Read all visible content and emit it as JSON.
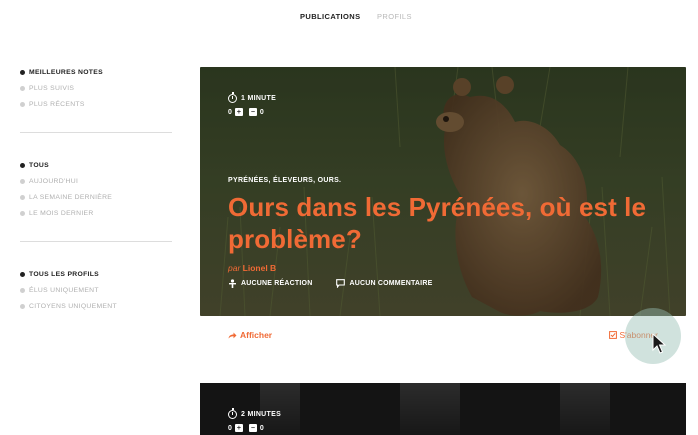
{
  "tabs": {
    "active": "PUBLICATIONS",
    "inactive": "PROFILS"
  },
  "sidebar": {
    "sort": [
      {
        "label": "MEILLEURES NOTES",
        "active": true
      },
      {
        "label": "PLUS SUIVIS",
        "active": false
      },
      {
        "label": "PLUS RÉCENTS",
        "active": false
      }
    ],
    "period": [
      {
        "label": "TOUS",
        "active": true
      },
      {
        "label": "AUJOURD'HUI",
        "active": false
      },
      {
        "label": "LA SEMAINE DERNIÈRE",
        "active": false
      },
      {
        "label": "LE MOIS DERNIER",
        "active": false
      }
    ],
    "profiles": [
      {
        "label": "TOUS LES PROFILS",
        "active": true
      },
      {
        "label": "ÉLUS UNIQUEMENT",
        "active": false
      },
      {
        "label": "CITOYENS UNIQUEMENT",
        "active": false
      }
    ]
  },
  "card1": {
    "readtime": "1 MINUTE",
    "votes_up": "0",
    "votes_down": "0",
    "tags": "PYRÉNÉES, ÉLEVEURS, OURS.",
    "title": "Ours dans les Pyrénées, où est le problème?",
    "by_prefix": "par",
    "author": "Lionel B",
    "reactions": "AUCUNE RÉACTION",
    "comments": "AUCUN COMMENTAIRE",
    "show_label": "Afficher",
    "subscribe_label": "S'abonner"
  },
  "card2": {
    "readtime": "2 MINUTES",
    "votes_up": "0",
    "votes_down": "0"
  },
  "colors": {
    "accent": "#f06a35",
    "text": "#222222",
    "muted": "#b0b0b0"
  },
  "icons": [
    "stopwatch-icon",
    "plus-icon",
    "minus-icon",
    "reaction-icon",
    "comment-icon",
    "share-arrow-icon",
    "checkbox-icon",
    "cursor-icon"
  ]
}
